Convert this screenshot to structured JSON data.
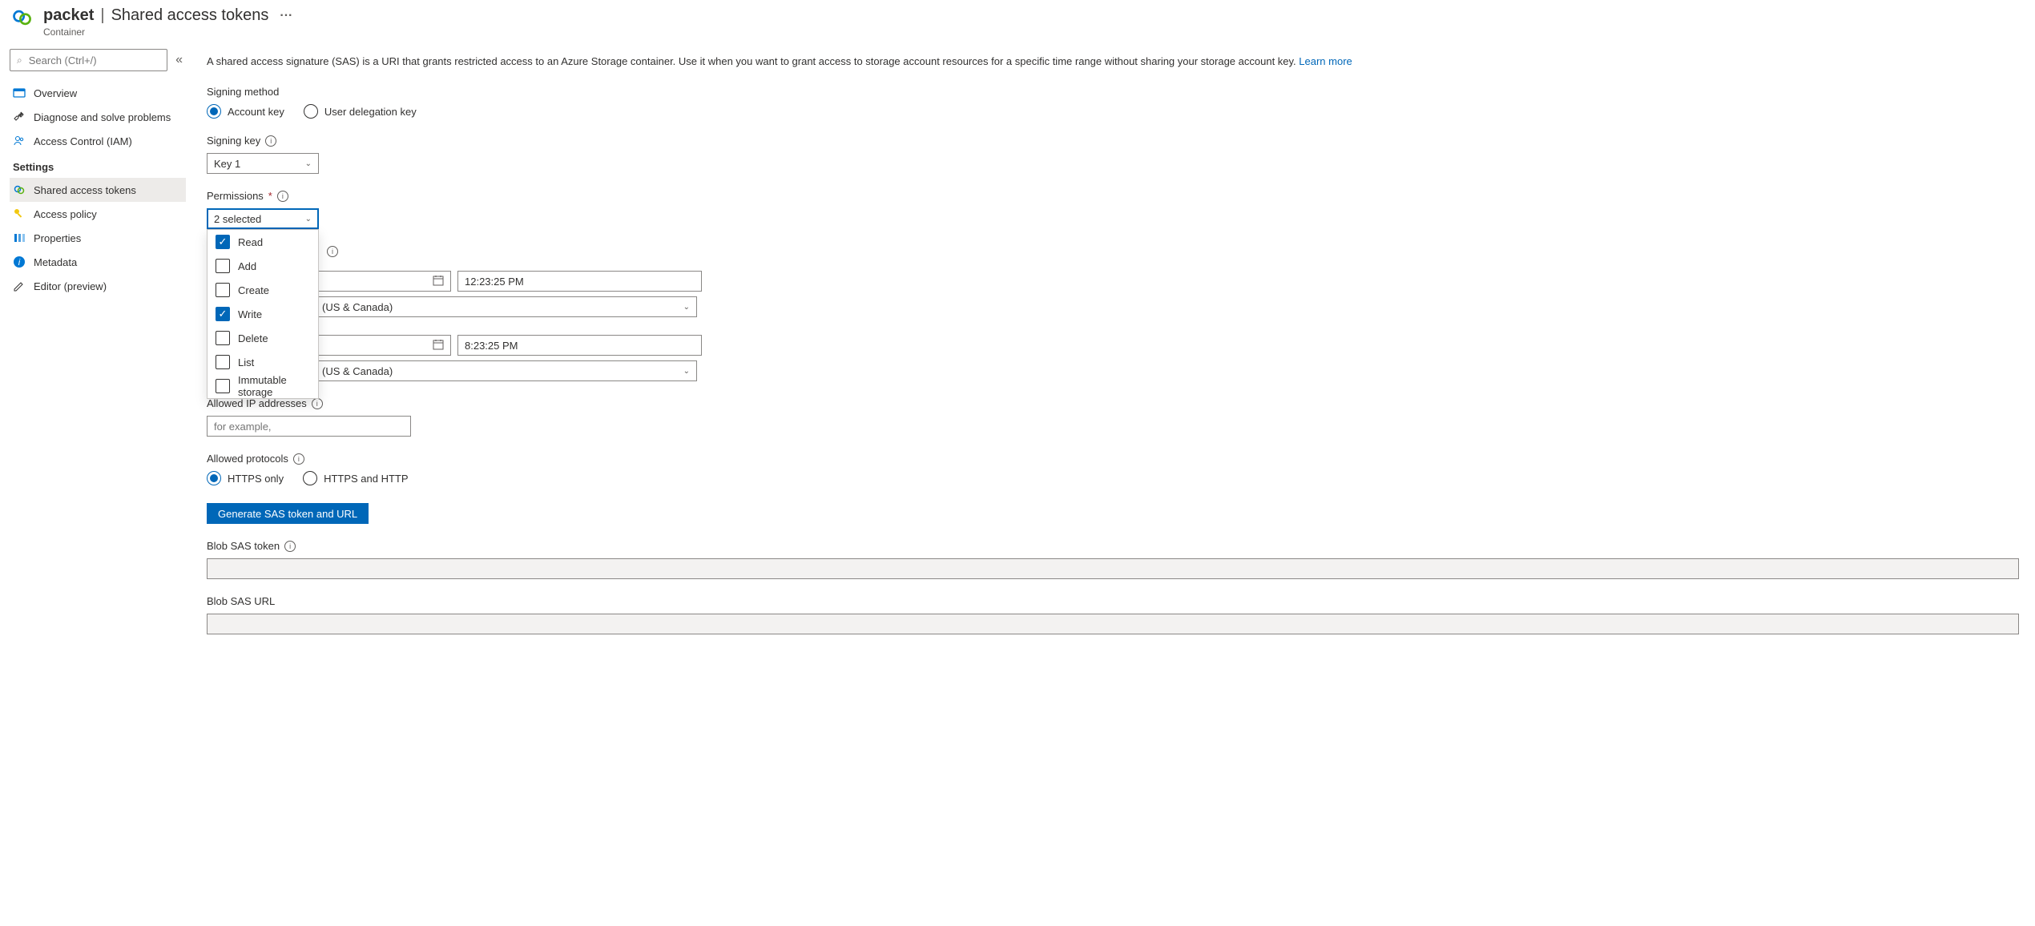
{
  "header": {
    "resource_name": "packet",
    "separator": "|",
    "page_title": "Shared access tokens",
    "resource_type": "Container",
    "more": "···"
  },
  "sidebar": {
    "search_placeholder": "Search (Ctrl+/)",
    "collapse_glyph": "«",
    "items_top": [
      {
        "id": "overview",
        "label": "Overview"
      },
      {
        "id": "diagnose",
        "label": "Diagnose and solve problems"
      },
      {
        "id": "iam",
        "label": "Access Control (IAM)"
      }
    ],
    "group_label": "Settings",
    "items_settings": [
      {
        "id": "sas",
        "label": "Shared access tokens",
        "active": true
      },
      {
        "id": "policy",
        "label": "Access policy"
      },
      {
        "id": "properties",
        "label": "Properties"
      },
      {
        "id": "metadata",
        "label": "Metadata"
      },
      {
        "id": "editor",
        "label": "Editor (preview)"
      }
    ]
  },
  "main": {
    "intro_text": "A shared access signature (SAS) is a URI that grants restricted access to an Azure Storage container. Use it when you want to grant access to storage account resources for a specific time range without sharing your storage account key. ",
    "learn_more": "Learn more",
    "signing_method": {
      "label": "Signing method",
      "options": {
        "account_key": "Account key",
        "user_delegation": "User delegation key"
      },
      "selected": "account_key"
    },
    "signing_key": {
      "label": "Signing key",
      "value": "Key 1"
    },
    "permissions": {
      "label": "Permissions",
      "display": "2 selected",
      "options": [
        {
          "id": "read",
          "label": "Read",
          "checked": true
        },
        {
          "id": "add",
          "label": "Add",
          "checked": false
        },
        {
          "id": "create",
          "label": "Create",
          "checked": false
        },
        {
          "id": "write",
          "label": "Write",
          "checked": true
        },
        {
          "id": "delete",
          "label": "Delete",
          "checked": false
        },
        {
          "id": "list",
          "label": "List",
          "checked": false
        },
        {
          "id": "immutable",
          "label": "Immutable storage",
          "checked": false
        }
      ]
    },
    "start": {
      "time": "12:23:25 PM",
      "tz_visible": "(US & Canada)"
    },
    "expiry": {
      "time": "8:23:25 PM",
      "tz_visible": "(US & Canada)"
    },
    "allowed_ip": {
      "label": "Allowed IP addresses",
      "placeholder": "for example,"
    },
    "allowed_protocols": {
      "label": "Allowed protocols",
      "options": {
        "https": "HTTPS only",
        "both": "HTTPS and HTTP"
      },
      "selected": "https"
    },
    "generate_button": "Generate SAS token and URL",
    "blob_sas_token_label": "Blob SAS token",
    "blob_sas_url_label": "Blob SAS URL"
  },
  "glyphs": {
    "search": "🔍",
    "chevron_down": "⌄",
    "calendar": "📅",
    "check": "✓",
    "info": "i"
  }
}
